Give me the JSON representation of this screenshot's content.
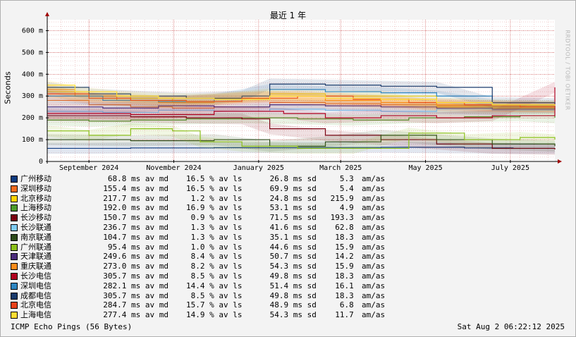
{
  "chart_data": {
    "type": "line",
    "title": "最近 1 年",
    "ylabel": "Seconds",
    "ylim": [
      0,
      650
    ],
    "yticks": [
      0,
      100,
      200,
      300,
      400,
      500,
      600
    ],
    "ytick_labels": [
      "0",
      "100 m",
      "200 m",
      "300 m",
      "400 m",
      "500 m",
      "600 m"
    ],
    "xlim": [
      "2024-08-02",
      "2025-08-02"
    ],
    "xticks": [
      "2024-09-01",
      "2024-11-01",
      "2025-01-01",
      "2025-03-01",
      "2025-05-01",
      "2025-07-01"
    ],
    "xtick_labels": [
      "September 2024",
      "November 2024",
      "January 2025",
      "March 2025",
      "May 2025",
      "July 2025"
    ],
    "grid": true,
    "legend_position": "bottom-left",
    "series": [
      {
        "name": "广州移动",
        "color": "#0d3b80",
        "avg_ms": 68.8,
        "loss_pct": 16.5,
        "sd_ms": 26.8,
        "am_as": 5.3,
        "values": [
          [
            0,
            60
          ],
          [
            30,
            60
          ],
          [
            60,
            62
          ],
          [
            120,
            63
          ],
          [
            180,
            64
          ],
          [
            240,
            65
          ],
          [
            300,
            62
          ],
          [
            335,
            60
          ],
          [
            365,
            60
          ]
        ]
      },
      {
        "name": "深圳移动",
        "color": "#f26b1d",
        "avg_ms": 155.4,
        "loss_pct": 16.5,
        "sd_ms": 69.9,
        "am_as": 5.4,
        "values": [
          [
            0,
            280
          ],
          [
            30,
            260
          ],
          [
            60,
            250
          ],
          [
            90,
            245
          ],
          [
            120,
            250
          ],
          [
            160,
            270
          ],
          [
            200,
            265
          ],
          [
            240,
            260
          ],
          [
            280,
            255
          ],
          [
            320,
            250
          ],
          [
            365,
            248
          ]
        ]
      },
      {
        "name": "北京移动",
        "color": "#ffd400",
        "avg_ms": 217.7,
        "loss_pct": 1.2,
        "sd_ms": 24.8,
        "am_as": 215.9,
        "values": [
          [
            0,
            320
          ],
          [
            30,
            300
          ],
          [
            60,
            290
          ],
          [
            90,
            270
          ],
          [
            120,
            285
          ],
          [
            160,
            310
          ],
          [
            200,
            300
          ],
          [
            240,
            300
          ],
          [
            280,
            250
          ],
          [
            320,
            245
          ],
          [
            365,
            240
          ]
        ]
      },
      {
        "name": "上海移动",
        "color": "#4c9a2a",
        "avg_ms": 192.0,
        "loss_pct": 16.9,
        "sd_ms": 53.1,
        "am_as": 4.9,
        "values": [
          [
            0,
            190
          ],
          [
            30,
            185
          ],
          [
            60,
            190
          ],
          [
            100,
            195
          ],
          [
            140,
            200
          ],
          [
            180,
            195
          ],
          [
            220,
            190
          ],
          [
            260,
            200
          ],
          [
            300,
            205
          ],
          [
            340,
            210
          ],
          [
            365,
            200
          ]
        ]
      },
      {
        "name": "长沙移动",
        "color": "#7a0010",
        "avg_ms": 150.7,
        "loss_pct": 0.9,
        "sd_ms": 71.5,
        "am_as": 193.3,
        "values": [
          [
            0,
            210
          ],
          [
            60,
            205
          ],
          [
            100,
            200
          ],
          [
            140,
            195
          ],
          [
            160,
            150
          ],
          [
            200,
            120
          ],
          [
            240,
            100
          ],
          [
            280,
            80
          ],
          [
            320,
            60
          ],
          [
            365,
            55
          ]
        ]
      },
      {
        "name": "长沙联通",
        "color": "#7ecbf2",
        "avg_ms": 236.7,
        "loss_pct": 1.3,
        "sd_ms": 41.6,
        "am_as": 62.8,
        "values": [
          [
            0,
            230
          ],
          [
            40,
            225
          ],
          [
            80,
            235
          ],
          [
            120,
            230
          ],
          [
            160,
            240
          ],
          [
            200,
            235
          ],
          [
            240,
            230
          ],
          [
            280,
            240
          ],
          [
            320,
            235
          ],
          [
            365,
            240
          ]
        ]
      },
      {
        "name": "南京联通",
        "color": "#2d4a1a",
        "avg_ms": 104.7,
        "loss_pct": 1.3,
        "sd_ms": 35.1,
        "am_as": 18.3,
        "values": [
          [
            0,
            100
          ],
          [
            60,
            95
          ],
          [
            120,
            100
          ],
          [
            160,
            70
          ],
          [
            200,
            90
          ],
          [
            240,
            120
          ],
          [
            280,
            100
          ],
          [
            320,
            80
          ],
          [
            365,
            70
          ]
        ]
      },
      {
        "name": "广州联通",
        "color": "#8bbf1a",
        "avg_ms": 95.4,
        "loss_pct": 1.0,
        "sd_ms": 44.6,
        "am_as": 15.9,
        "values": [
          [
            0,
            140
          ],
          [
            30,
            120
          ],
          [
            60,
            150
          ],
          [
            90,
            140
          ],
          [
            110,
            90
          ],
          [
            140,
            70
          ],
          [
            180,
            60
          ],
          [
            220,
            60
          ],
          [
            260,
            130
          ],
          [
            300,
            100
          ],
          [
            340,
            110
          ],
          [
            365,
            100
          ]
        ]
      },
      {
        "name": "天津联通",
        "color": "#4a2b7a",
        "avg_ms": 249.6,
        "loss_pct": 8.4,
        "sd_ms": 50.7,
        "am_as": 14.2,
        "values": [
          [
            0,
            250
          ],
          [
            40,
            245
          ],
          [
            80,
            255
          ],
          [
            120,
            250
          ],
          [
            160,
            260
          ],
          [
            200,
            255
          ],
          [
            240,
            250
          ],
          [
            280,
            245
          ],
          [
            320,
            240
          ],
          [
            365,
            245
          ]
        ]
      },
      {
        "name": "重庆联通",
        "color": "#ff8c1a",
        "avg_ms": 273.0,
        "loss_pct": 8.2,
        "sd_ms": 54.3,
        "am_as": 15.9,
        "values": [
          [
            0,
            330
          ],
          [
            20,
            300
          ],
          [
            50,
            280
          ],
          [
            80,
            270
          ],
          [
            120,
            290
          ],
          [
            160,
            300
          ],
          [
            200,
            280
          ],
          [
            240,
            270
          ],
          [
            280,
            260
          ],
          [
            320,
            255
          ],
          [
            365,
            250
          ]
        ]
      },
      {
        "name": "长沙电信",
        "color": "#b00020",
        "avg_ms": 305.7,
        "loss_pct": 8.5,
        "sd_ms": 49.8,
        "am_as": 18.3,
        "values": [
          [
            0,
            220
          ],
          [
            60,
            215
          ],
          [
            120,
            230
          ],
          [
            170,
            220
          ],
          [
            200,
            200
          ],
          [
            240,
            210
          ],
          [
            280,
            200
          ],
          [
            320,
            210
          ],
          [
            365,
            340
          ]
        ]
      },
      {
        "name": "深圳电信",
        "color": "#2e86c1",
        "avg_ms": 282.1,
        "loss_pct": 14.4,
        "sd_ms": 51.4,
        "am_as": 16.1,
        "values": [
          [
            0,
            300
          ],
          [
            40,
            280
          ],
          [
            80,
            275
          ],
          [
            120,
            285
          ],
          [
            160,
            330
          ],
          [
            200,
            320
          ],
          [
            240,
            315
          ],
          [
            280,
            300
          ],
          [
            320,
            260
          ],
          [
            365,
            255
          ]
        ]
      },
      {
        "name": "成都电信",
        "color": "#1a3a6b",
        "avg_ms": 305.7,
        "loss_pct": 8.5,
        "sd_ms": 49.8,
        "am_as": 18.3,
        "values": [
          [
            0,
            340
          ],
          [
            30,
            310
          ],
          [
            60,
            300
          ],
          [
            100,
            290
          ],
          [
            140,
            300
          ],
          [
            160,
            355
          ],
          [
            200,
            350
          ],
          [
            240,
            345
          ],
          [
            280,
            340
          ],
          [
            320,
            270
          ],
          [
            365,
            265
          ]
        ]
      },
      {
        "name": "北京电信",
        "color": "#e8411a",
        "avg_ms": 284.7,
        "loss_pct": 15.7,
        "sd_ms": 48.9,
        "am_as": 6.8,
        "values": [
          [
            0,
            310
          ],
          [
            30,
            290
          ],
          [
            60,
            280
          ],
          [
            100,
            275
          ],
          [
            140,
            290
          ],
          [
            180,
            300
          ],
          [
            220,
            285
          ],
          [
            260,
            270
          ],
          [
            300,
            260
          ],
          [
            340,
            250
          ],
          [
            365,
            250
          ]
        ]
      },
      {
        "name": "上海电信",
        "color": "#ffdd33",
        "avg_ms": 277.4,
        "loss_pct": 14.9,
        "sd_ms": 54.3,
        "am_as": 11.7,
        "values": [
          [
            0,
            350
          ],
          [
            20,
            320
          ],
          [
            50,
            300
          ],
          [
            80,
            290
          ],
          [
            120,
            285
          ],
          [
            160,
            300
          ],
          [
            200,
            290
          ],
          [
            240,
            285
          ],
          [
            280,
            270
          ],
          [
            320,
            260
          ],
          [
            365,
            255
          ]
        ]
      }
    ]
  },
  "labels": {
    "av": "av",
    "md": "md",
    "ls": "ls",
    "sd": "sd",
    "ms": "ms",
    "pct": "%",
    "unit": "am/as"
  },
  "footer": {
    "left": "ICMP Echo Pings (56 Bytes)",
    "right": "Sat Aug  2 06:22:12 2025"
  },
  "watermark": "RRDTOOL / TOBI OETIKER",
  "colors": {
    "background": "#f3f3f3",
    "plot_bg": "#ffffff",
    "grid_minor": "#e6b0b0",
    "grid_major": "#d06060",
    "axis": "#000000",
    "arrow": "#a00000"
  }
}
